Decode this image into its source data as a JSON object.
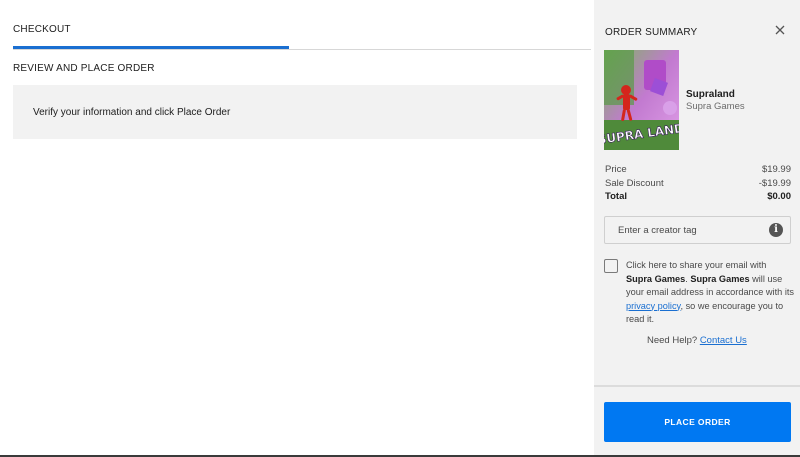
{
  "checkout": {
    "tab_label": "CHECKOUT",
    "section_title": "REVIEW AND PLACE ORDER",
    "info_message": "Verify your information and click Place Order"
  },
  "summary": {
    "title": "ORDER SUMMARY",
    "close_icon": "close-icon",
    "product": {
      "name": "Supraland",
      "publisher": "Supra Games",
      "cover_logo_text": "SUPRA LAND"
    },
    "price_rows": [
      {
        "label": "Price",
        "value": "$19.99"
      },
      {
        "label": "Sale Discount",
        "value": "-$19.99"
      },
      {
        "label": "Total",
        "value": "$0.00"
      }
    ],
    "creator_tag": {
      "placeholder": "Enter a creator tag",
      "value": "",
      "info_icon": "info-icon"
    },
    "share": {
      "checked": false,
      "text_1": "Click here to share your email with ",
      "publisher_1": "Supra Games",
      "text_2": ". ",
      "publisher_2": "Supra Games",
      "text_3": " will use your email address in accordance with its ",
      "link_text": "privacy policy",
      "text_4": ", so we encourage you to read it."
    },
    "help": {
      "prefix": "Need Help? ",
      "link_text": "Contact Us"
    },
    "place_order_label": "PLACE ORDER"
  },
  "colors": {
    "accent": "#0078f2",
    "tab_underline": "#1a6fd1",
    "link": "#1a6fd1",
    "panel_bg": "#f2f2f2"
  }
}
